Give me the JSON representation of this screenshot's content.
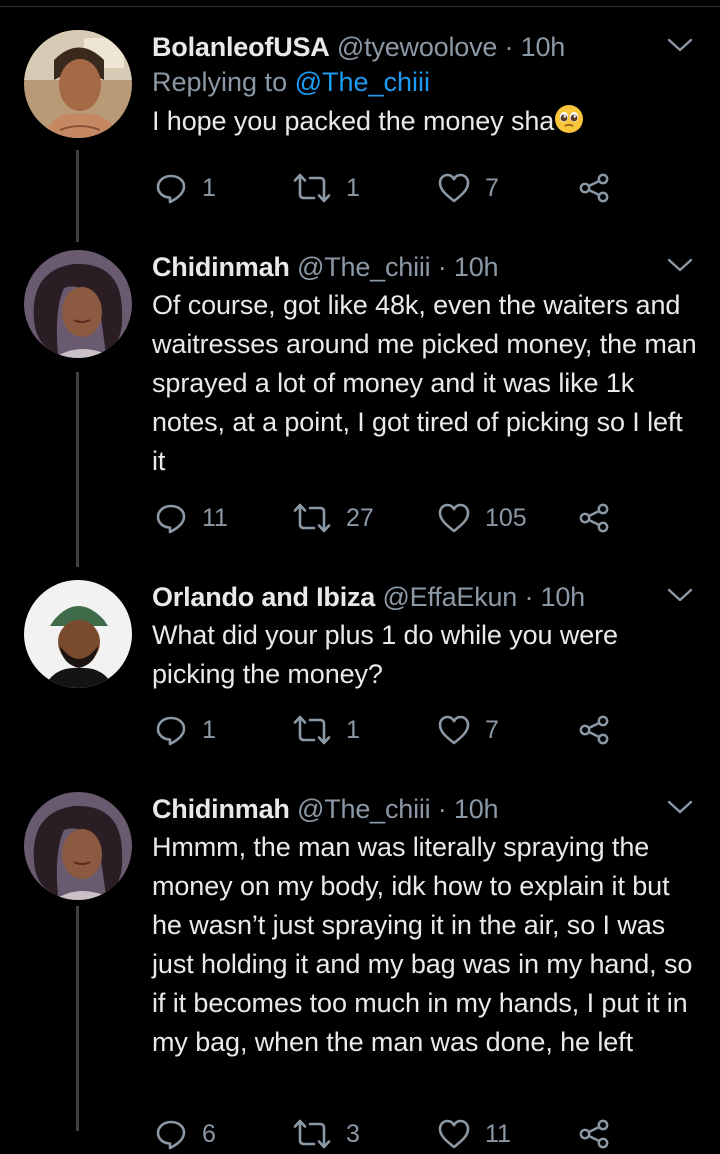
{
  "tweets": [
    {
      "display_name": "BolanleofUSA",
      "handle": "@tyewoolove",
      "time": "· 10h",
      "replying_prefix": "Replying to ",
      "replying_to": "@The_chiii",
      "text": "I hope you packed the money sha",
      "emoji": "pleading-face-emoji",
      "replies": "1",
      "retweets": "1",
      "likes": "7"
    },
    {
      "display_name": "Chidinmah",
      "handle": "@The_chiii",
      "time": "· 10h",
      "text": "Of course, got like 48k, even the waiters and waitresses around me picked money, the man sprayed a lot of money and it was like 1k notes, at a point, I got tired of picking so I left it",
      "replies": "11",
      "retweets": "27",
      "likes": "105"
    },
    {
      "display_name": "Orlando and Ibiza",
      "handle": "@EffaEkun",
      "time": "· 10h",
      "text": "What did your plus 1 do while you were picking the money?",
      "replies": "1",
      "retweets": "1",
      "likes": "7"
    },
    {
      "display_name": "Chidinmah",
      "handle": "@The_chiii",
      "time": "· 10h",
      "text": "Hmmm, the man was literally spraying the money on my body, idk how to explain it but he wasn’t just spraying it in the air, so I was just holding it and my bag was in my hand, so if it becomes too much in my hands, I put it in my bag, when the man was done, he left",
      "replies": "6",
      "retweets": "3",
      "likes": "11"
    }
  ],
  "colors": {
    "background": "#000000",
    "text": "#e7e9ea",
    "secondary": "#8b98a5",
    "mention": "#1d9bf0",
    "thread_line": "#3d4247"
  },
  "icons": [
    "reply-icon",
    "retweet-icon",
    "like-icon",
    "share-icon",
    "chevron-down-icon"
  ]
}
